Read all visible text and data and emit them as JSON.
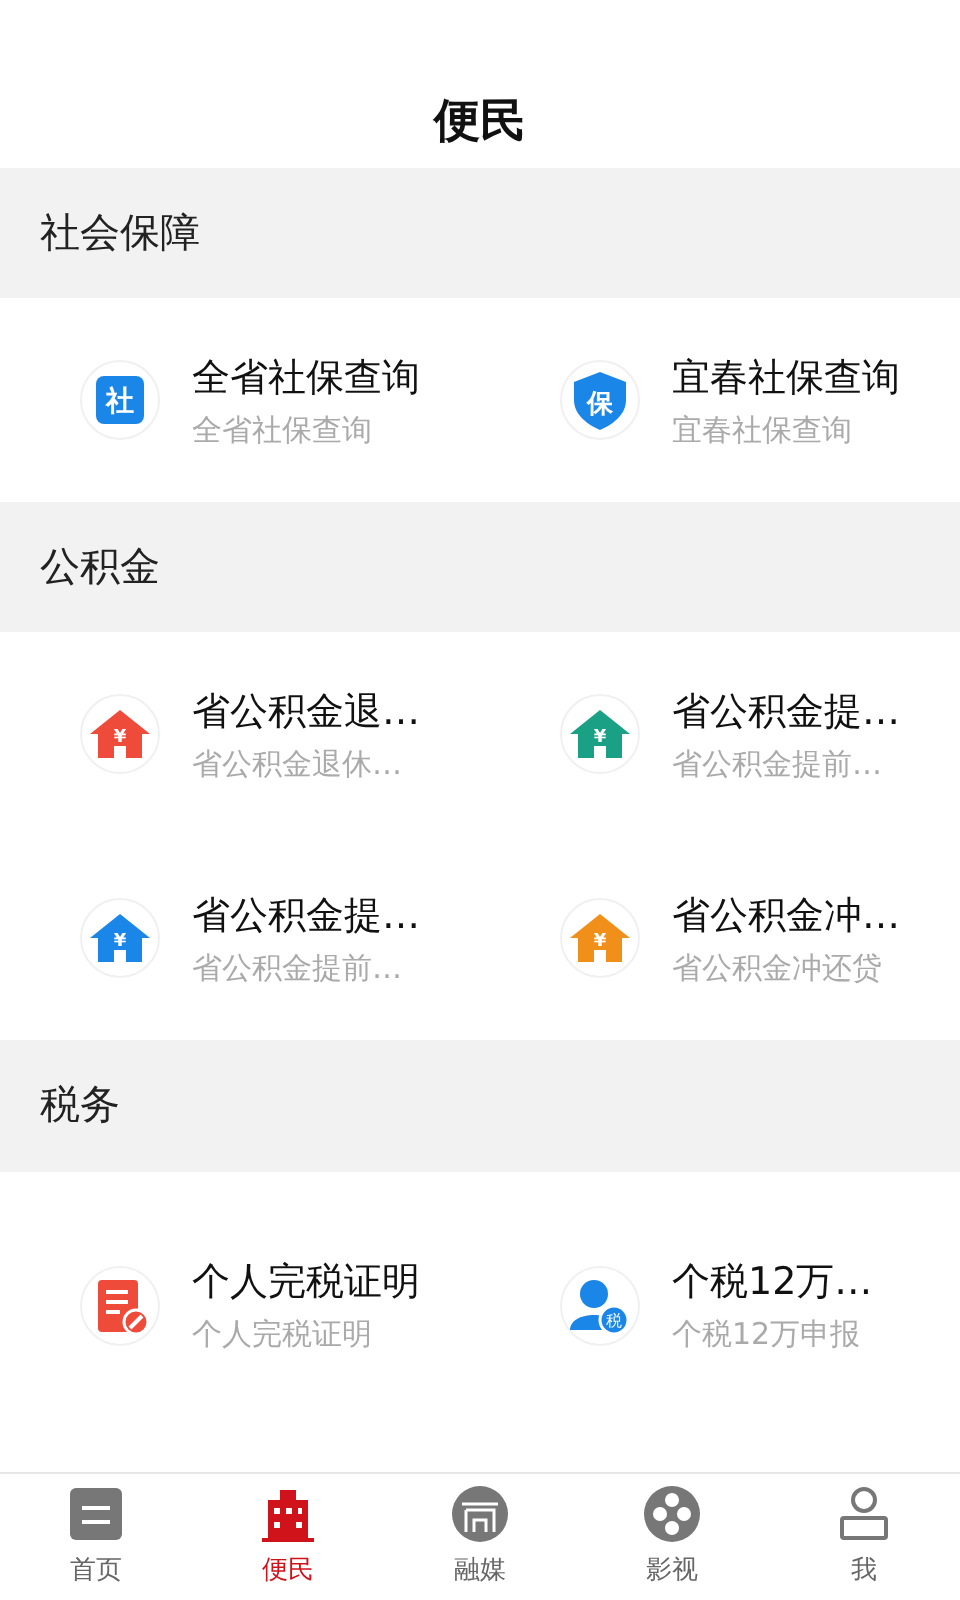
{
  "header": {
    "title": "便民"
  },
  "sections": [
    {
      "title": "社会保障",
      "items": [
        {
          "title": "全省社保查询",
          "subtitle": "全省社保查询",
          "icon": {
            "kind": "badge",
            "glyph": "社",
            "color": "#1a86e8"
          }
        },
        {
          "title": "宜春社保查询",
          "subtitle": "宜春社保查询",
          "icon": {
            "kind": "shield",
            "glyph": "保",
            "color": "#1a86e8"
          }
        }
      ]
    },
    {
      "title": "公积金",
      "items": [
        {
          "title": "省公积金退…",
          "subtitle": "省公积金退休…",
          "icon": {
            "kind": "house",
            "glyph": "¥",
            "color": "#ee4b3b"
          }
        },
        {
          "title": "省公积金提…",
          "subtitle": "省公积金提前…",
          "icon": {
            "kind": "house",
            "glyph": "¥",
            "color": "#1aa185"
          }
        },
        {
          "title": "省公积金提…",
          "subtitle": "省公积金提前…",
          "icon": {
            "kind": "house",
            "glyph": "¥",
            "color": "#1a86e8"
          }
        },
        {
          "title": "省公积金冲…",
          "subtitle": "省公积金冲还贷",
          "icon": {
            "kind": "house",
            "glyph": "¥",
            "color": "#f0901a"
          }
        }
      ]
    },
    {
      "title": "税务",
      "items": [
        {
          "title": "个人完税证明",
          "subtitle": "个人完税证明",
          "icon": {
            "kind": "document",
            "color": "#ee4b3b"
          }
        },
        {
          "title": "个税12万…",
          "subtitle": "个税12万申报",
          "icon": {
            "kind": "person",
            "glyph": "税",
            "color": "#1a86e8"
          }
        }
      ]
    }
  ],
  "tabs": [
    {
      "label": "首页",
      "kind": "news",
      "selected": false
    },
    {
      "label": "便民",
      "kind": "building",
      "selected": true
    },
    {
      "label": "融媒",
      "kind": "gate",
      "selected": false
    },
    {
      "label": "影视",
      "kind": "film",
      "selected": false
    },
    {
      "label": "我",
      "kind": "person",
      "selected": false
    }
  ]
}
